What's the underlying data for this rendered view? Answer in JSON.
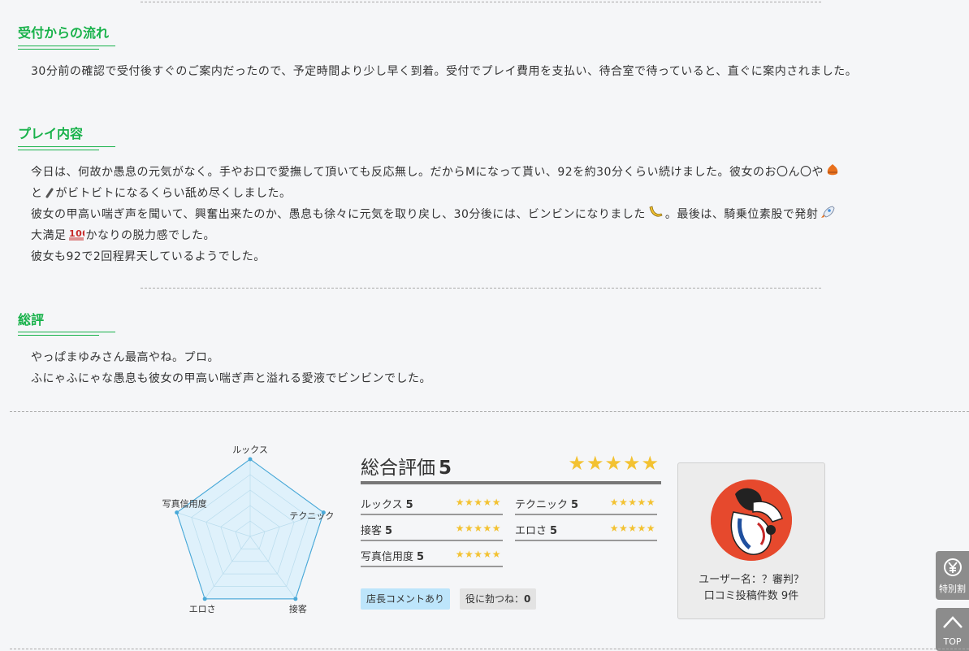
{
  "flow": {
    "title": "受付からの流れ",
    "text": "30分前の確認で受付後すぐのご案内だったので、予定時間より少し早く到着。受付でプレイ費用を支払い、待合室で待っていると、直ぐに案内されました。"
  },
  "play": {
    "title": "プレイ内容",
    "line1a": "今日は、何故か愚息の元気がなく。手やお口で愛撫して頂いても反応無し。だからMになって貰い、92を約30分くらい続けました。彼女のお〇ん〇や",
    "line1b": "と",
    "line1c": "がビトビトになるくらい舐め尽くしました。",
    "line2a": "彼女の甲高い喘ぎ声を聞いて、興奮出来たのか、愚息も徐々に元気を取り戻し、30分後には、ビンビンになりました",
    "line2b": "。最後は、騎乗位素股で発射",
    "line3a": "大満足",
    "line3b": "かなりの脱力感でした。",
    "line4": "彼女も92で2回程昇天しているようでした。"
  },
  "summary": {
    "title": "総評",
    "line1": "やっぱまゆみさん最高やね。プロ。",
    "line2": "ふにゃふにゃな愚息も彼女の甲高い喘ぎ声と溢れる愛液でビンビンでした。"
  },
  "radar": {
    "labels": [
      "ルックス",
      "テクニック",
      "接客",
      "エロさ",
      "写真信用度"
    ],
    "values": [
      5,
      5,
      5,
      5,
      5
    ],
    "max": 5,
    "fill": "#dff1fb",
    "stroke": "#4aa9d8",
    "grid": "#b9dced"
  },
  "overall": {
    "label": "総合評価",
    "score": "5",
    "stars": "★★★★★"
  },
  "ratings": [
    {
      "label": "ルックス",
      "value": "5",
      "stars": "★★★★★"
    },
    {
      "label": "テクニック",
      "value": "5",
      "stars": "★★★★★"
    },
    {
      "label": "接客",
      "value": "5",
      "stars": "★★★★★"
    },
    {
      "label": "エロさ",
      "value": "5",
      "stars": "★★★★★"
    },
    {
      "label": "写真信用度",
      "value": "5",
      "stars": "★★★★★"
    }
  ],
  "badges": {
    "comment": "店長コメントあり",
    "helpful_label": "役に勃つね：",
    "helpful_count": "0"
  },
  "user": {
    "name": "ユーザー名：？審判？",
    "count": "口コミ投稿件数 9件"
  },
  "side": {
    "special_icon": "¥",
    "special": "特別割",
    "top": "TOP"
  },
  "colors": {
    "accent": "#19b24b",
    "star": "#f3c232"
  }
}
